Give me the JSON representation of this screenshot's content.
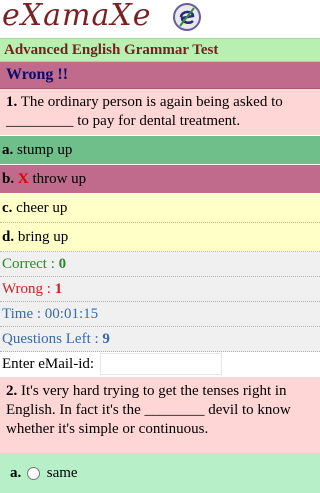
{
  "app": {
    "logo_text": "eXamaXe",
    "logo_icon": "examaxe-e-logo-icon"
  },
  "header": {
    "title": "Advanced English Grammar Test"
  },
  "status": {
    "message": "Wrong !!"
  },
  "question1": {
    "number": "1.",
    "text": "The ordinary person is again being asked to _________ to pay for dental treatment."
  },
  "options": [
    {
      "letter": "a.",
      "text": "stump up",
      "state": "correct"
    },
    {
      "letter": "b.",
      "mark": "X",
      "text": "throw up",
      "state": "wrong"
    },
    {
      "letter": "c.",
      "text": "cheer up",
      "state": "normal"
    },
    {
      "letter": "d.",
      "text": "bring up",
      "state": "normal"
    }
  ],
  "stats": {
    "correct_label": "Correct :",
    "correct_value": "0",
    "wrong_label": "Wrong :",
    "wrong_value": "1",
    "time_label": "Time :",
    "time_value": "00:01:15",
    "left_label": "Questions Left :",
    "left_value": "9"
  },
  "email": {
    "label": "Enter eMail-id:",
    "value": ""
  },
  "question2": {
    "number": "2.",
    "text": "It's very hard trying to get the tenses right in English. In fact it's the ________ devil to know whether it's simple or continuous."
  },
  "next_option": {
    "letter": "a.",
    "text": "same"
  },
  "colors": {
    "title_bg": "#b7f0b0",
    "wrong_bg": "#c06a8c",
    "correct_bg": "#6fbf8a",
    "option_bg": "#ffffc8",
    "question_bg": "#ffd6d6"
  }
}
